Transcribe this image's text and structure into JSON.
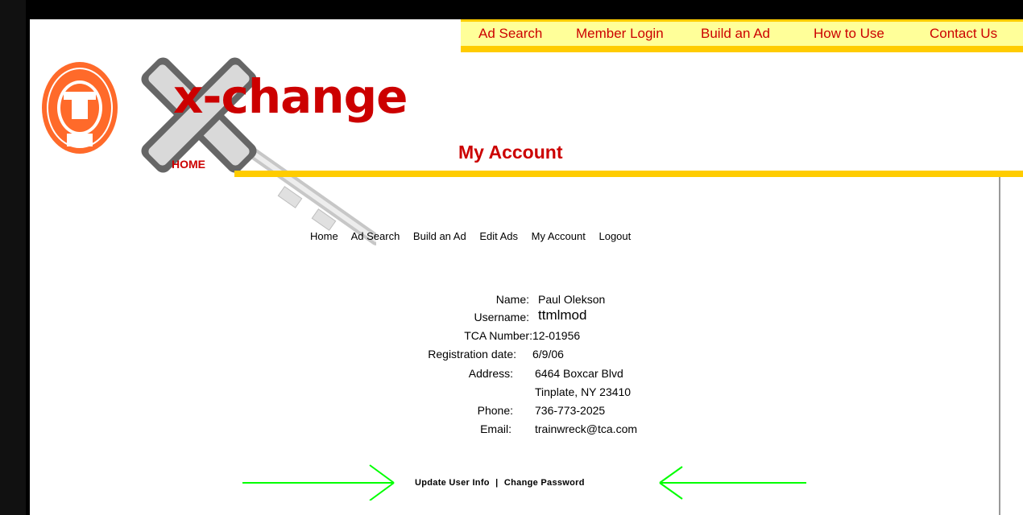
{
  "top_nav": {
    "items": [
      "Ad Search",
      "Member Login",
      "Build an Ad",
      "How to Use",
      "Contact Us"
    ]
  },
  "brand": {
    "name": "x-change",
    "home_label": "HOME"
  },
  "page_title": "My Account",
  "sub_nav": {
    "items": [
      "Home",
      "Ad Search",
      "Build an Ad",
      "Edit Ads",
      "My Account",
      "Logout"
    ]
  },
  "account": {
    "labels": {
      "name": "Name:",
      "username": "Username:",
      "tca_number": "TCA Number:",
      "registration_date": "Registration date:",
      "address": "Address:",
      "phone": "Phone:",
      "email": "Email:"
    },
    "values": {
      "name": "Paul Olekson",
      "username": "ttmlmod",
      "tca_number": "12-01956",
      "registration_date": "6/9/06",
      "address_line1": "6464 Boxcar Blvd",
      "address_line2": "Tinplate, NY 23410",
      "phone": "736-773-2025",
      "email": "trainwreck@tca.com"
    }
  },
  "bottom_links": {
    "update": "Update User Info",
    "separator": "|",
    "change_password": "Change Password"
  },
  "colors": {
    "accent_red": "#cc0000",
    "nav_yellow": "#ffcc00",
    "arrow_green": "#00ff00"
  }
}
